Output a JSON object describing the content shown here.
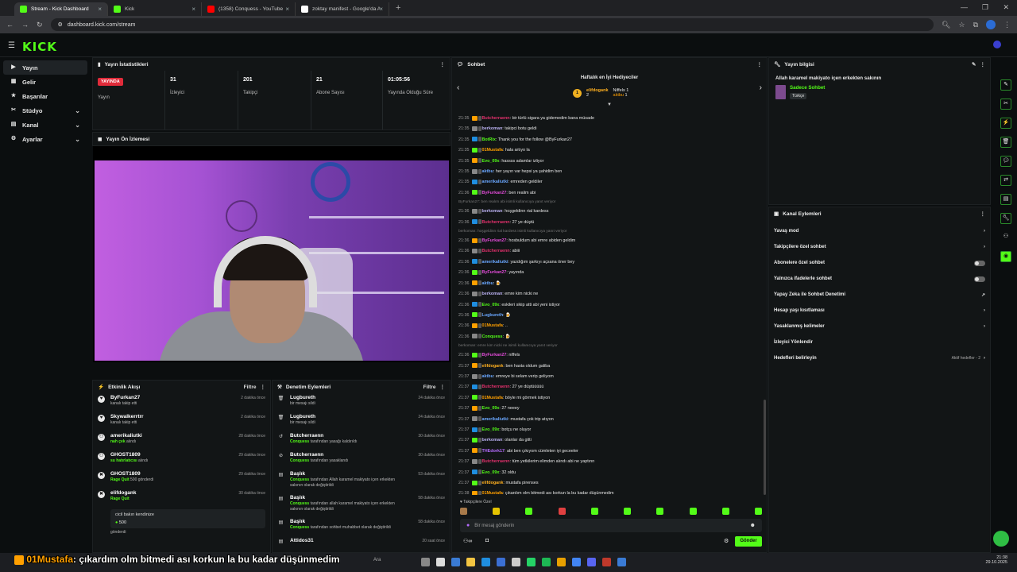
{
  "browser": {
    "tabs": [
      {
        "label": "Stream - Kick Dashboard",
        "color": "#53fc18",
        "active": true
      },
      {
        "label": "Kick",
        "color": "#53fc18",
        "active": false
      },
      {
        "label": "(1358) Conquess - YouTube",
        "color": "#ff0000",
        "active": false
      },
      {
        "label": "zoktay manifest - Google'da Ar",
        "color": "#ffffff",
        "active": false
      }
    ],
    "url": "dashboard.kick.com/stream"
  },
  "sidebar": {
    "items": [
      {
        "label": "Yayın",
        "icon": "broadcast-icon",
        "selected": true,
        "expandable": false
      },
      {
        "label": "Gelir",
        "icon": "wallet-icon",
        "selected": false,
        "expandable": false
      },
      {
        "label": "Başarılar",
        "icon": "trophy-icon",
        "selected": false,
        "expandable": false
      },
      {
        "label": "Stüdyo",
        "icon": "studio-icon",
        "selected": false,
        "expandable": true
      },
      {
        "label": "Kanal",
        "icon": "channel-icon",
        "selected": false,
        "expandable": true
      },
      {
        "label": "Ayarlar",
        "icon": "gear-icon",
        "selected": false,
        "expandable": true
      }
    ]
  },
  "stats": {
    "title": "Yayın İstatistikleri",
    "live_badge": "YAYINDA",
    "live_label": "Yayın",
    "cells": [
      {
        "value": "31",
        "label": "İzleyici"
      },
      {
        "value": "201",
        "label": "Takipçi"
      },
      {
        "value": "21",
        "label": "Abone Sayısı"
      },
      {
        "value": "01:05:56",
        "label": "Yayında Olduğu Süre"
      }
    ]
  },
  "preview": {
    "title": "Yayın Ön İzlemesi"
  },
  "activity": {
    "title": "Etkinlik Akışı",
    "filter": "Filtre",
    "items": [
      {
        "title": "ByFurkan27",
        "sub": "kanalı takip etti",
        "time": "2 dakika önce"
      },
      {
        "title": "Skywalkerrtrr",
        "sub": "kanalı takip etti",
        "time": "2 dakika önce"
      },
      {
        "title": "amerikaliutki",
        "sub_hl": "nah çek",
        "sub": "alındı",
        "time": "28 dakika önce"
      },
      {
        "title": "GHOST1809",
        "sub_hl": "su hatırlatıcısı",
        "sub": "alındı",
        "time": "29 dakika önce"
      },
      {
        "title": "GHOST1809",
        "sub_hl": "Rage Quit",
        "sub": "500 gönderdi",
        "time": "29 dakika önce"
      },
      {
        "title": "elifdogank",
        "sub_hl": "Rage Quit",
        "sub": "",
        "time": "30 dakika önce"
      }
    ],
    "quote": "cicil bakın kendinize",
    "quote_amount": "500",
    "trailing": "gönderdi"
  },
  "moderation": {
    "title": "Denetim Eylemleri",
    "filter": "Filtre",
    "items": [
      {
        "title": "Lugbureth",
        "sub": "bir mesajı sildi",
        "time": "24 dakika önce"
      },
      {
        "title": "Lugbureth",
        "sub": "bir mesajı sildi",
        "time": "24 dakika önce"
      },
      {
        "title": "Butcherraenn",
        "sub_hl": "Conquess",
        "sub": "tarafından yasağı kaldırıldı",
        "time": "30 dakika önce"
      },
      {
        "title": "Butcherraenn",
        "sub_hl": "Conquess",
        "sub": "tarafından yasaklandı",
        "time": "30 dakika önce"
      },
      {
        "title": "Başlık",
        "sub_hl": "Conquess",
        "sub": "tarafından Allah karamel makiyato içen erkekten sakının olarak değiştirildi",
        "time": "53 dakika önce"
      },
      {
        "title": "Başlık",
        "sub_hl": "Conquess",
        "sub": "tarafından allah karamel makiyato içen erkekten sakının olarak değiştirildi",
        "time": "58 dakika önce"
      },
      {
        "title": "Başlık",
        "sub_hl": "Conquess",
        "sub": "tarafından sohbet muhabbet olarak değiştirildi",
        "time": "58 dakika önce"
      },
      {
        "title": "Attidos31",
        "sub": "",
        "time": "20 saat önce"
      }
    ]
  },
  "chat": {
    "title": "Sohbet",
    "gifters_title": "Haftalık en İyi Hediyeciler",
    "gifters": [
      {
        "name": "elifdogank",
        "count": "2",
        "rank": "1"
      },
      {
        "name": "Niffels",
        "count": "1"
      },
      {
        "name": "aktbu",
        "count": "1"
      }
    ],
    "messages": [
      {
        "time": "21:35",
        "user": "Butcherraenn",
        "color": "#e0306b",
        "text": "bir türlü sigara ya gidemedim bana müsade"
      },
      {
        "time": "21:35",
        "user": "berkoman",
        "color": "#b9b0f0",
        "text": "takipci botu geldi"
      },
      {
        "time": "21:35",
        "user": "BotRix",
        "color": "#53fc18",
        "text": "Thank you for the follow @ByFurkan27"
      },
      {
        "time": "21:35",
        "user": "01Mustafa",
        "color": "#ffa000",
        "text": "hala artıyo la"
      },
      {
        "time": "21:35",
        "user": "Evo_09x",
        "color": "#53fc18",
        "text": "hassss adamlar izliyor"
      },
      {
        "time": "21:35",
        "user": "aktbu",
        "color": "#6aa7ff",
        "text": "her yayın var hepsi ya şahidim ben"
      },
      {
        "time": "21:35",
        "user": "amerikaliutki",
        "color": "#6aa7ff",
        "text": "emreden geldiler"
      },
      {
        "time": "21:36",
        "user": "ByFurkan27",
        "color": "#e24bd8",
        "text": "ben realim abi"
      },
      {
        "system": "ByFurkan27: ben realım abi isimli kullanıcıya yanıt veriyor"
      },
      {
        "time": "21:36",
        "user": "berkoman",
        "color": "#b9b0f0",
        "text": "hoşgeldinn rial kardess"
      },
      {
        "time": "21:36",
        "user": "Butcherraenn",
        "color": "#e0306b",
        "text": "27 ye düştü"
      },
      {
        "system": "berkoman: hoşgeldinn rial kardess isimli kullanıcıya yanıt veriyor"
      },
      {
        "time": "21:36",
        "user": "ByFurkan27",
        "color": "#e24bd8",
        "text": "hosbuldum abi emre abiden geldim"
      },
      {
        "time": "21:36",
        "user": "Butcherraenn",
        "color": "#e0306b",
        "text": "abiii"
      },
      {
        "time": "21:36",
        "user": "amerikaliutki",
        "color": "#6aa7ff",
        "text": "yazdığım şarkıyı açsana öner bey"
      },
      {
        "time": "21:36",
        "user": "ByFurkan27",
        "color": "#e24bd8",
        "text": "yayında"
      },
      {
        "time": "21:36",
        "user": "aktbu",
        "color": "#6aa7ff",
        "text": "🍺"
      },
      {
        "time": "21:36",
        "user": "berkoman",
        "color": "#b9b0f0",
        "text": "emre kim nicki ne"
      },
      {
        "time": "21:36",
        "user": "Evo_09x",
        "color": "#53fc18",
        "text": "eskileri sikip atti abi yeni istiyor"
      },
      {
        "time": "21:36",
        "user": "Lugbureth",
        "color": "#6aa7ff",
        "text": "🍺"
      },
      {
        "time": "21:36",
        "user": "01Mustafa",
        "color": "#ffa000",
        "text": ".."
      },
      {
        "time": "21:36",
        "user": "Conquess",
        "color": "#53fc18",
        "text": "🍺"
      },
      {
        "system": "berkoman: emre kim nicki ne isimli kullanıcıya yanıt veriyor"
      },
      {
        "time": "21:36",
        "user": "ByFurkan27",
        "color": "#e24bd8",
        "text": "niffels"
      },
      {
        "time": "21:37",
        "user": "elifdogank",
        "color": "#ffb020",
        "text": "ben hasta oldum galiba"
      },
      {
        "time": "21:37",
        "user": "aktbu",
        "color": "#6aa7ff",
        "text": "emreye bi selam verip geliyom"
      },
      {
        "time": "21:37",
        "user": "Butcherraenn",
        "color": "#e0306b",
        "text": "27 ye düştüüüüü"
      },
      {
        "time": "21:37",
        "user": "01Mustafa",
        "color": "#ffa000",
        "text": "böyle mi görmek istiyon"
      },
      {
        "time": "21:37",
        "user": "Evo_09x",
        "color": "#53fc18",
        "text": "27 neeey"
      },
      {
        "time": "21:37",
        "user": "amerikaliutki",
        "color": "#6aa7ff",
        "text": "mustafa çok trip atıyon"
      },
      {
        "time": "21:37",
        "user": "Evo_09x",
        "color": "#53fc18",
        "text": "botçu ne oluyor"
      },
      {
        "time": "21:37",
        "user": "berkoman",
        "color": "#b9b0f0",
        "text": "olanlar da gitti"
      },
      {
        "time": "21:37",
        "user": "THEdork17",
        "color": "#b56cff",
        "text": "abi ben çıkıyom cümleten iyi geceeler"
      },
      {
        "time": "21:37",
        "user": "Butcherraenn",
        "color": "#e0306b",
        "text": "tüm yetkilerim elimden alındı abi ne yaptınn"
      },
      {
        "time": "21:37",
        "user": "Evo_09x",
        "color": "#53fc18",
        "text": "32 oldu"
      },
      {
        "time": "21:37",
        "user": "elifdogank",
        "color": "#ffb020",
        "text": "mustafa pirenses"
      },
      {
        "time": "21:38",
        "user": "01Mustafa",
        "color": "#ffa000",
        "text": "çıkardım olm bitmedi ası korkun la bu kadar düşünmedim"
      }
    ],
    "mode_label": "Takipçilere Özel",
    "input_placeholder": "Bir mesaj gönderin",
    "send_label": "Gönder"
  },
  "stream_info": {
    "title": "Yayın bilgisi",
    "stream_title": "Allah karamel makiyato içen erkekten sakının",
    "category": "Sadece Sohbet",
    "language": "Türkçe"
  },
  "channel_actions": {
    "title": "Kanal Eylemleri",
    "items": [
      {
        "label": "Yavaş mod",
        "control": "chevron"
      },
      {
        "label": "Takipçilere özel sohbet",
        "control": "chevron"
      },
      {
        "label": "Abonelere özel sohbet",
        "control": "toggle"
      },
      {
        "label": "Yalnızca ifadelerle sohbet",
        "control": "toggle"
      },
      {
        "label": "Yapay Zeka ile Sohbet Denetimi",
        "control": "external"
      },
      {
        "label": "Hesap yaşı kısıtlaması",
        "control": "chevron"
      },
      {
        "label": "Yasaklanmış kelimeler",
        "control": "chevron"
      },
      {
        "label": "İzleyici Yönlendir",
        "control": "none"
      },
      {
        "label": "Hedefleri belirleyin",
        "control": "chevron",
        "extra": "Aktif hedefler - 2"
      }
    ]
  },
  "overlay_caption": {
    "user": "01Mustafa",
    "text": ": çıkardım olm bitmedi ası korkun la bu kadar düşünmedim"
  },
  "taskbar": {
    "search_hint": "Ara",
    "time": "21:38",
    "date": "29.10.2025"
  },
  "colors": {
    "accent": "#53fc18",
    "live": "#e02b3a",
    "bg": "#0b0e0f",
    "panel": "#121516"
  }
}
